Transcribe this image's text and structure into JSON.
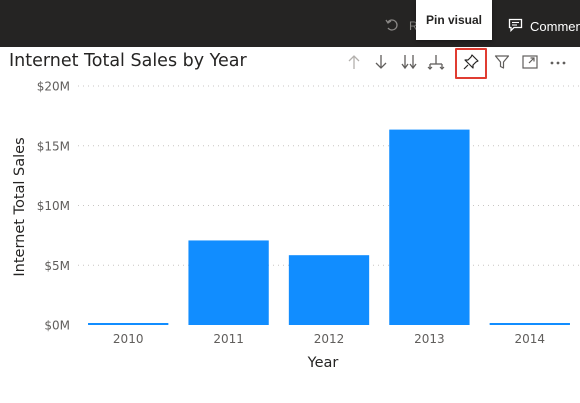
{
  "topbar": {
    "reset_label": "Re",
    "comment_label": "Comment"
  },
  "tooltip": {
    "text": "Pin visual"
  },
  "visual": {
    "title": "Internet Total Sales by Year",
    "header_icons": [
      "drill-up-icon",
      "drill-down-icon",
      "expand-all-down-icon",
      "go-to-next-level-icon",
      "pin-icon",
      "filter-icon",
      "focus-mode-icon",
      "more-options-icon"
    ]
  },
  "colors": {
    "bar": "#118dff",
    "topbar": "#252423",
    "highlight": "#e03c31"
  },
  "chart_data": {
    "type": "bar",
    "title": "Internet Total Sales by Year",
    "xlabel": "Year",
    "ylabel": "Internet Total Sales",
    "categories": [
      "2010",
      "2011",
      "2012",
      "2013",
      "2014"
    ],
    "values": [
      43421.04,
      7075525.93,
      5842485.2,
      16351550.34,
      45694.72
    ],
    "ylim": [
      0,
      20000000
    ],
    "yticks": [
      0,
      5000000,
      10000000,
      15000000,
      20000000
    ],
    "ytick_labels": [
      "$0M",
      "$5M",
      "$10M",
      "$15M",
      "$20M"
    ],
    "grid": true,
    "grid_style": "dotted"
  }
}
